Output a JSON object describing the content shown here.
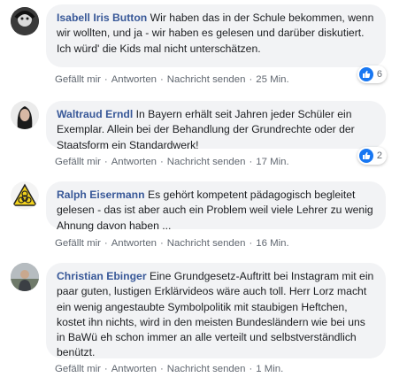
{
  "comments": [
    {
      "author": "Isabell Iris Button",
      "text": "Wir haben das in der Schule bekommen, wenn wir wollten, und ja - wir haben es gelesen und darüber diskutiert.\nIch würd' die Kids mal nicht unterschätzen.",
      "reaction_count": "6",
      "actions": {
        "like": "Gefällt mir",
        "reply": "Antworten",
        "message": "Nachricht senden",
        "time": "25 Min."
      }
    },
    {
      "author": "Waltraud Erndl",
      "text": "In Bayern erhält seit Jahren jeder Schüler ein Exemplar. Allein bei der Behandlung der Grundrechte oder der Staatsform ein Standardwerk!",
      "reaction_count": "2",
      "actions": {
        "like": "Gefällt mir",
        "reply": "Antworten",
        "message": "Nachricht senden",
        "time": "17 Min."
      }
    },
    {
      "author": "Ralph Eisermann",
      "text": "Es gehört kompetent pädagogisch begleitet gelesen - das ist aber auch ein Problem weil viele Lehrer zu wenig Ahnung davon haben ...",
      "actions": {
        "like": "Gefällt mir",
        "reply": "Antworten",
        "message": "Nachricht senden",
        "time": "16 Min."
      }
    },
    {
      "author": "Christian Ebinger",
      "text": "Eine Grundgesetz-Auftritt bei Instagram mit ein paar guten, lustigen Erklärvideos wäre auch toll. Herr Lorz macht ein wenig angestaubte Symbolpolitik mit staubigen Heftchen, kostet ihn nichts, wird in den meisten Bundesländern wie bei uns in BaWü eh schon immer an alle verteilt und selbstverständlich benützt.",
      "actions": {
        "like": "Gefällt mir",
        "reply": "Antworten",
        "message": "Nachricht senden",
        "time": "1 Min."
      }
    }
  ],
  "colors": {
    "author": "#385898",
    "bubble": "#f2f3f5",
    "like": "#1877f2",
    "meta": "#606770"
  },
  "icons": {
    "reaction": "like-thumb-icon"
  }
}
